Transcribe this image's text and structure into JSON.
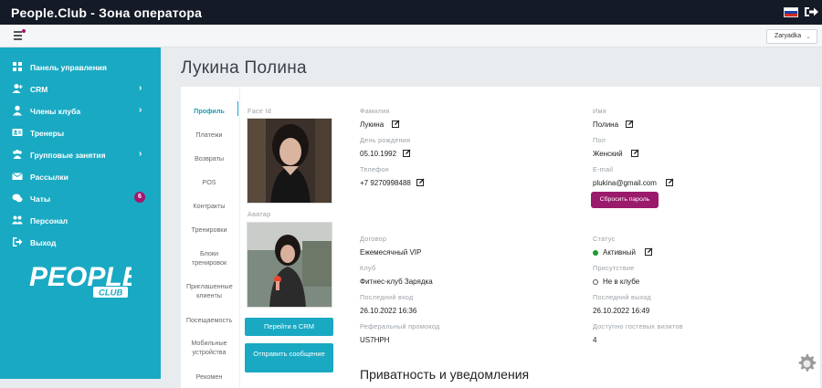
{
  "app": {
    "title": "People.Club - Зона оператора"
  },
  "subbar": {
    "club_select": "Zaryadka",
    "club_select_caret": "⌄"
  },
  "sidebar": {
    "items": [
      {
        "label": "Панель управления",
        "icon": "dashboard-icon",
        "chevron": ""
      },
      {
        "label": "CRM",
        "icon": "user-plus-icon",
        "chevron": "›"
      },
      {
        "label": "Члены клуба",
        "icon": "user-icon",
        "chevron": "›"
      },
      {
        "label": "Тренеры",
        "icon": "id-card-icon",
        "chevron": ""
      },
      {
        "label": "Групповые занятия",
        "icon": "users-icon",
        "chevron": "›"
      },
      {
        "label": "Рассылки",
        "icon": "envelope-icon",
        "chevron": ""
      },
      {
        "label": "Чаты",
        "icon": "chat-icon",
        "chevron": "",
        "badge": "6"
      },
      {
        "label": "Персонал",
        "icon": "staff-icon",
        "chevron": ""
      },
      {
        "label": "Выход",
        "icon": "sign-out-icon",
        "chevron": ""
      }
    ],
    "logo": {
      "main": "PEOPLE",
      "sub": "CLUB"
    }
  },
  "page": {
    "title": "Лукина Полина"
  },
  "tabs": [
    {
      "label": "Профиль"
    },
    {
      "label": "Платежи"
    },
    {
      "label": "Возвраты"
    },
    {
      "label": "POS"
    },
    {
      "label": "Контракты"
    },
    {
      "label": "Тренировки"
    },
    {
      "label": "Блоки тренировок"
    },
    {
      "label": "Приглашенные клиенты"
    },
    {
      "label": "Посещаемость"
    },
    {
      "label": "Мобильные устройства"
    },
    {
      "label": "Рекомен"
    }
  ],
  "photos": {
    "face_id_label": "Face Id",
    "avatar_label": "Аватар"
  },
  "buttons": {
    "go_crm": "Перейти в CRM",
    "send_message": "Отправить сообщение",
    "reset_password": "Сбросить пароль"
  },
  "profile": {
    "lastname_label": "Фамилия",
    "lastname": "Лукина",
    "birthday_label": "День рождения",
    "birthday": "05.10.1992",
    "phone_label": "Телефон",
    "phone": "+7 9270998488",
    "firstname_label": "Имя",
    "firstname": "Полина",
    "gender_label": "Пол",
    "gender": "Женский",
    "email_label": "E-mail",
    "email": "plukina@gmail.com",
    "contract_label": "Договор",
    "contract": "Ежемесячный VIP",
    "club_label": "Клуб",
    "club": "Фитнес-клуб Зарядка",
    "last_login_label": "Последний вход",
    "last_login": "26.10.2022 16:36",
    "promo_label": "Реферальный промокод",
    "promo": "US7HPH",
    "status_label": "Статус",
    "status": "Активный",
    "presence_label": "Присутствие",
    "presence": "Не в клубе",
    "last_exit_label": "Последний выход",
    "last_exit": "26.10.2022 16:49",
    "guest_visits_label": "Доступно гостевых визитов",
    "guest_visits": "4"
  },
  "section": {
    "privacy_title": "Приватность и уведомления"
  },
  "colors": {
    "sidebar": "#19a9c3",
    "topbar": "#141a26",
    "accent_button": "#19a9c3",
    "reset_button": "#9a1a6c",
    "status_active": "#1c9a2e"
  }
}
